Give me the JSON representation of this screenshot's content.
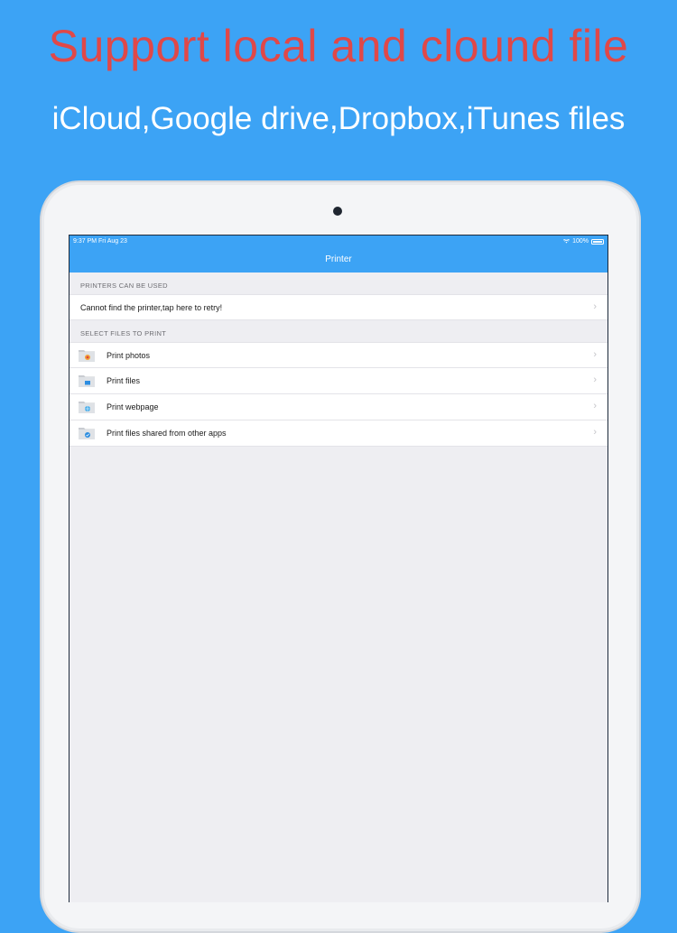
{
  "promo": {
    "headline": "Support local and clound file",
    "subline": "iCloud,Google drive,Dropbox,iTunes files"
  },
  "statusbar": {
    "time_date": "9:37 PM  Fri Aug 23",
    "battery": "100%"
  },
  "navbar": {
    "title": "Printer"
  },
  "sections": {
    "printers": {
      "header": "PRINTERS CAN BE USED",
      "retry_label": "Cannot find the printer,tap here to retry!"
    },
    "files": {
      "header": "SELECT FILES TO PRINT",
      "items": [
        {
          "label": "Print photos",
          "icon": "photos-folder-icon"
        },
        {
          "label": "Print files",
          "icon": "files-folder-icon"
        },
        {
          "label": "Print webpage",
          "icon": "webpage-folder-icon"
        },
        {
          "label": "Print files shared from other apps",
          "icon": "shared-folder-icon"
        }
      ]
    }
  },
  "colors": {
    "background": "#3ca3f5",
    "headline": "#e04848",
    "navbar": "#3ca3f5"
  }
}
